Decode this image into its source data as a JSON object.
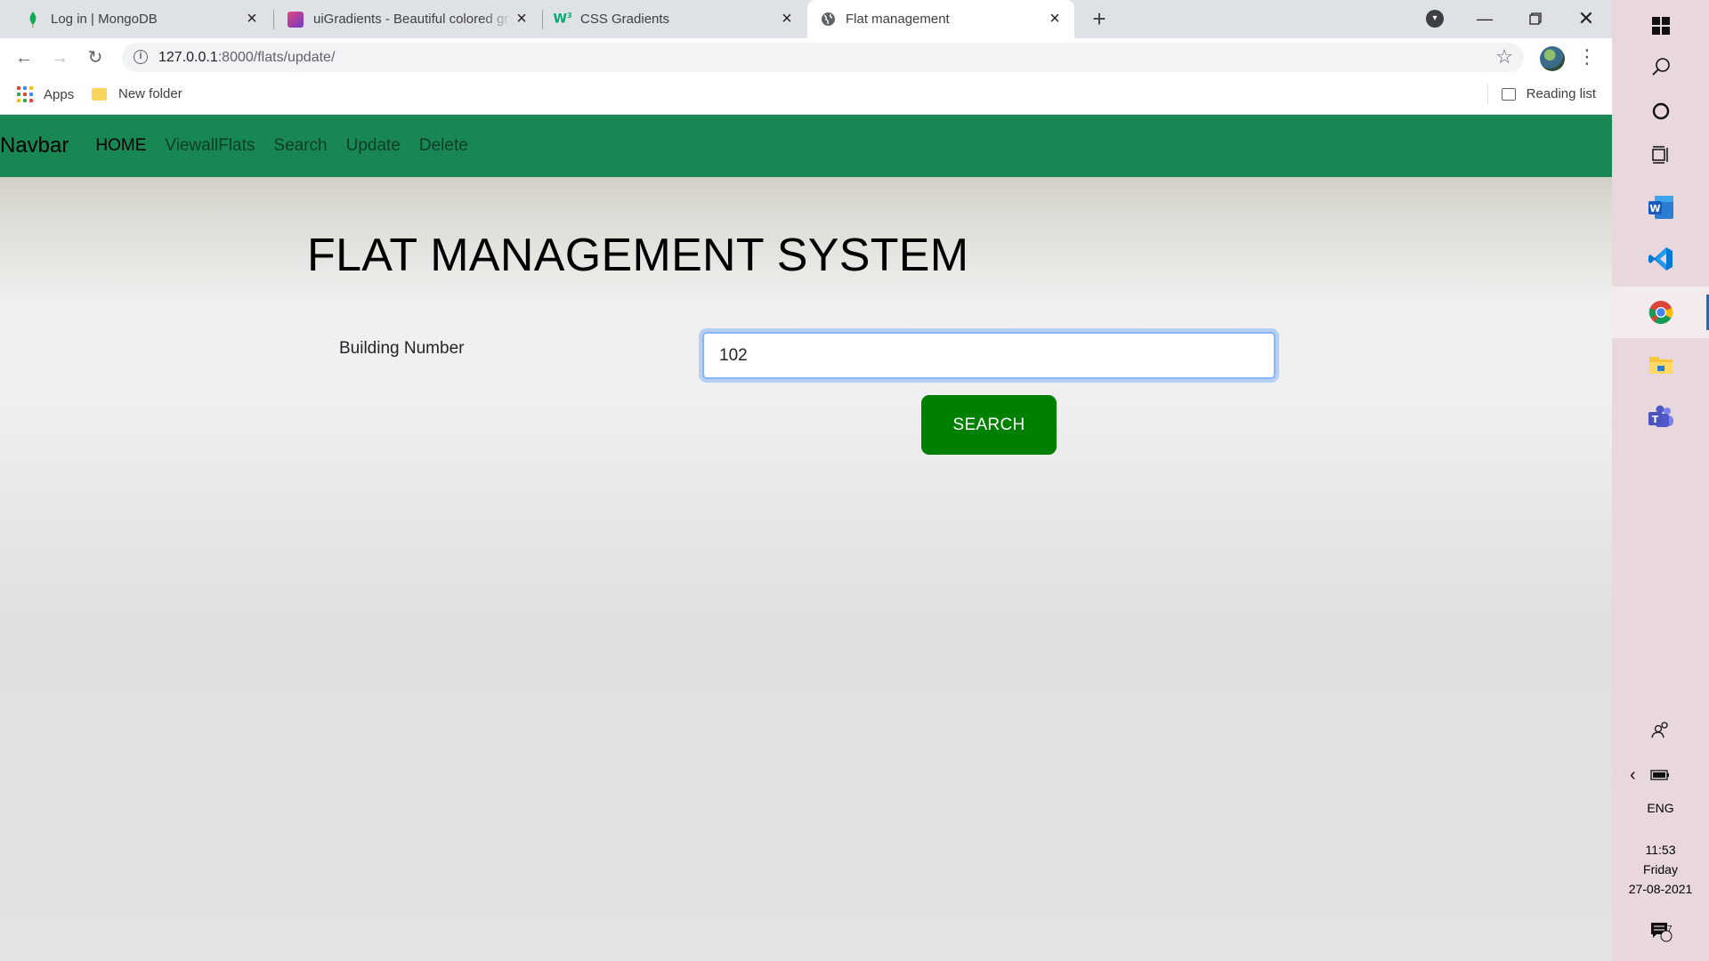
{
  "browser": {
    "tabs": [
      {
        "title": "Log in | MongoDB",
        "icon": "mongodb-leaf-icon",
        "active": false
      },
      {
        "title": "uiGradients - Beautiful colored gr",
        "icon": "uigradients-icon",
        "active": false
      },
      {
        "title": "CSS Gradients",
        "icon": "w3schools-icon",
        "active": false
      },
      {
        "title": "Flat management",
        "icon": "globe-icon",
        "active": true
      }
    ],
    "address": {
      "host": "127.0.0.1",
      "path": ":8000/flats/update/"
    },
    "bookmarks": [
      {
        "label": "Apps",
        "icon": "apps-grid-icon"
      },
      {
        "label": "New folder",
        "icon": "folder-icon"
      }
    ],
    "reading_list_label": "Reading list"
  },
  "page": {
    "navbar": {
      "brand": "Navbar",
      "links": [
        "HOME",
        "ViewallFlats",
        "Search",
        "Update",
        "Delete"
      ],
      "color": "#198754"
    },
    "heading": "FLAT MANAGEMENT SYSTEM",
    "form": {
      "label": "Building Number",
      "value": "102",
      "button_label": "SEARCH",
      "button_color": "#008000"
    }
  },
  "taskbar": {
    "apps": [
      "windows-start-icon",
      "search-icon",
      "cortana-icon",
      "task-view-icon",
      "word-icon",
      "vscode-icon",
      "chrome-icon",
      "file-explorer-icon",
      "teams-icon"
    ],
    "language": "ENG",
    "time": "11:53",
    "day": "Friday",
    "date": "27-08-2021",
    "notifications": "7"
  }
}
